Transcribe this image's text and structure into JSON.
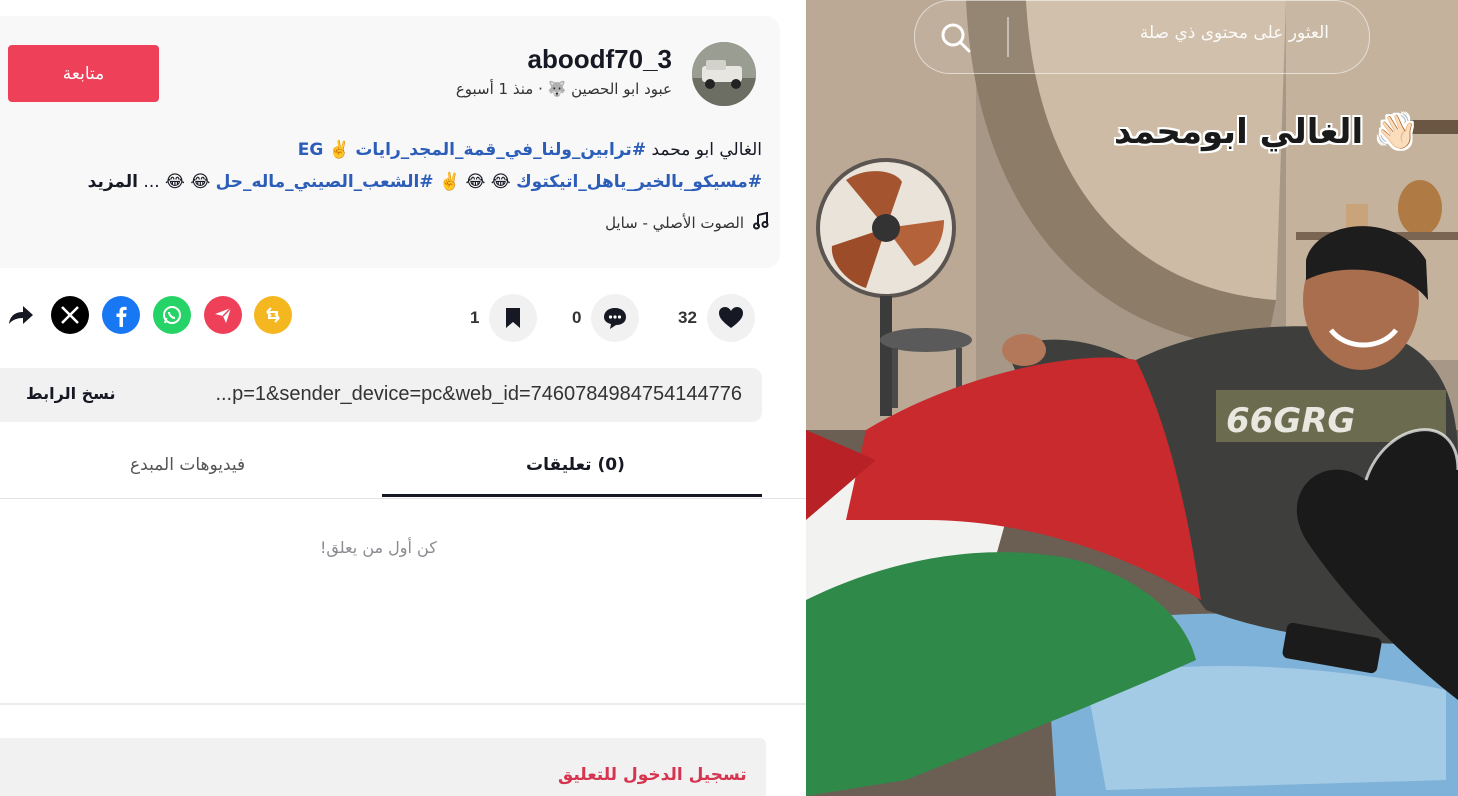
{
  "post": {
    "username": "aboodf70_3",
    "display_name": "عبود ابو الحصين",
    "time_ago": "· منذ 1 أسبوع",
    "follow_label": "متابعة",
    "caption_line1_plain": "الغالي ابو محمد",
    "caption_line1_tag": "#ترابين_ولنا_في_قمة_المجد_رايات",
    "caption_line1_end": "EG",
    "caption_line2_tag1": "#مسيكو_بالخير_ياهل_اتيكتوك",
    "caption_line2_tag2": "#الشعب_الصيني_ماله_حل",
    "caption_more": "المزيد",
    "caption_ellipsis": "...",
    "music": "الصوت الأصلي - سايل"
  },
  "actions": {
    "likes": "32",
    "comments": "0",
    "saves": "1"
  },
  "share": {
    "icons": [
      "repost-icon",
      "telegram-icon",
      "whatsapp-icon",
      "facebook-icon",
      "x-icon",
      "forward-icon"
    ],
    "url": "...p=1&sender_device=pc&web_id=7460784984754144776",
    "copy_label": "نسخ الرابط"
  },
  "tabs": {
    "comments": "(0) تعليقات",
    "creator_videos": "فيديوهات المبدع"
  },
  "comments": {
    "empty_text": "كن أول من يعلق!",
    "login_prompt": "تسجيل الدخول للتعليق"
  },
  "video": {
    "search_placeholder": "العثور على محتوى ذي صلة",
    "overlay_caption": "الغالي ابومحمد",
    "shirt_text": "66GRG"
  },
  "colors": {
    "follow": "#ee4059",
    "hashtag": "#2b5db9",
    "login": "#d6344f",
    "whatsapp": "#25d366",
    "facebook": "#1877f2",
    "telegram": "#ee4059",
    "repost": "#f5b720"
  }
}
